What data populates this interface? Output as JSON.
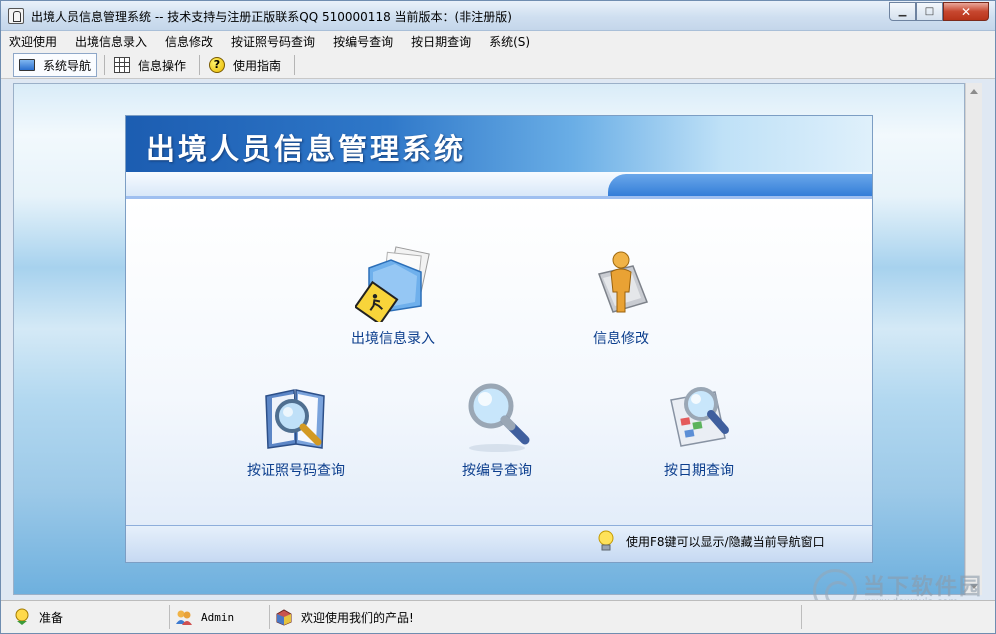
{
  "window": {
    "title": "出境人员信息管理系统 -- 技术支持与注册正版联系QQ 510000118    当前版本：(非注册版)",
    "controls": {
      "minimize": "▁",
      "maximize": "□",
      "close": "✕"
    }
  },
  "menu": {
    "items": [
      "欢迎使用",
      "出境信息录入",
      "信息修改",
      "按证照号码查询",
      "按编号查询",
      "按日期查询",
      "系统(S)"
    ]
  },
  "toolbar": {
    "buttons": [
      {
        "label": "系统导航",
        "icon": "monitor-icon"
      },
      {
        "label": "信息操作",
        "icon": "table-grid-icon"
      },
      {
        "label": "使用指南",
        "icon": "help-question-icon"
      }
    ]
  },
  "nav": {
    "title": "出境人员信息管理系统",
    "items": [
      {
        "label": "出境信息录入",
        "icon": "folder-documents-icon"
      },
      {
        "label": "信息修改",
        "icon": "person-edit-icon"
      },
      {
        "label": "按证照号码查询",
        "icon": "book-magnifier-icon"
      },
      {
        "label": "按编号查询",
        "icon": "magnifier-icon"
      },
      {
        "label": "按日期查询",
        "icon": "calendar-magnifier-icon"
      }
    ],
    "tip": "使用F8键可以显示/隐藏当前导航窗口"
  },
  "status": {
    "state": "准备",
    "user": "Admin",
    "message": "欢迎使用我们的产品!"
  },
  "watermark": {
    "name": "当下软件园",
    "url": "www.downxia.com"
  },
  "colors": {
    "title_blue": "#1c5db1",
    "link_blue": "#0c3e8d",
    "close_red": "#c7472f"
  }
}
